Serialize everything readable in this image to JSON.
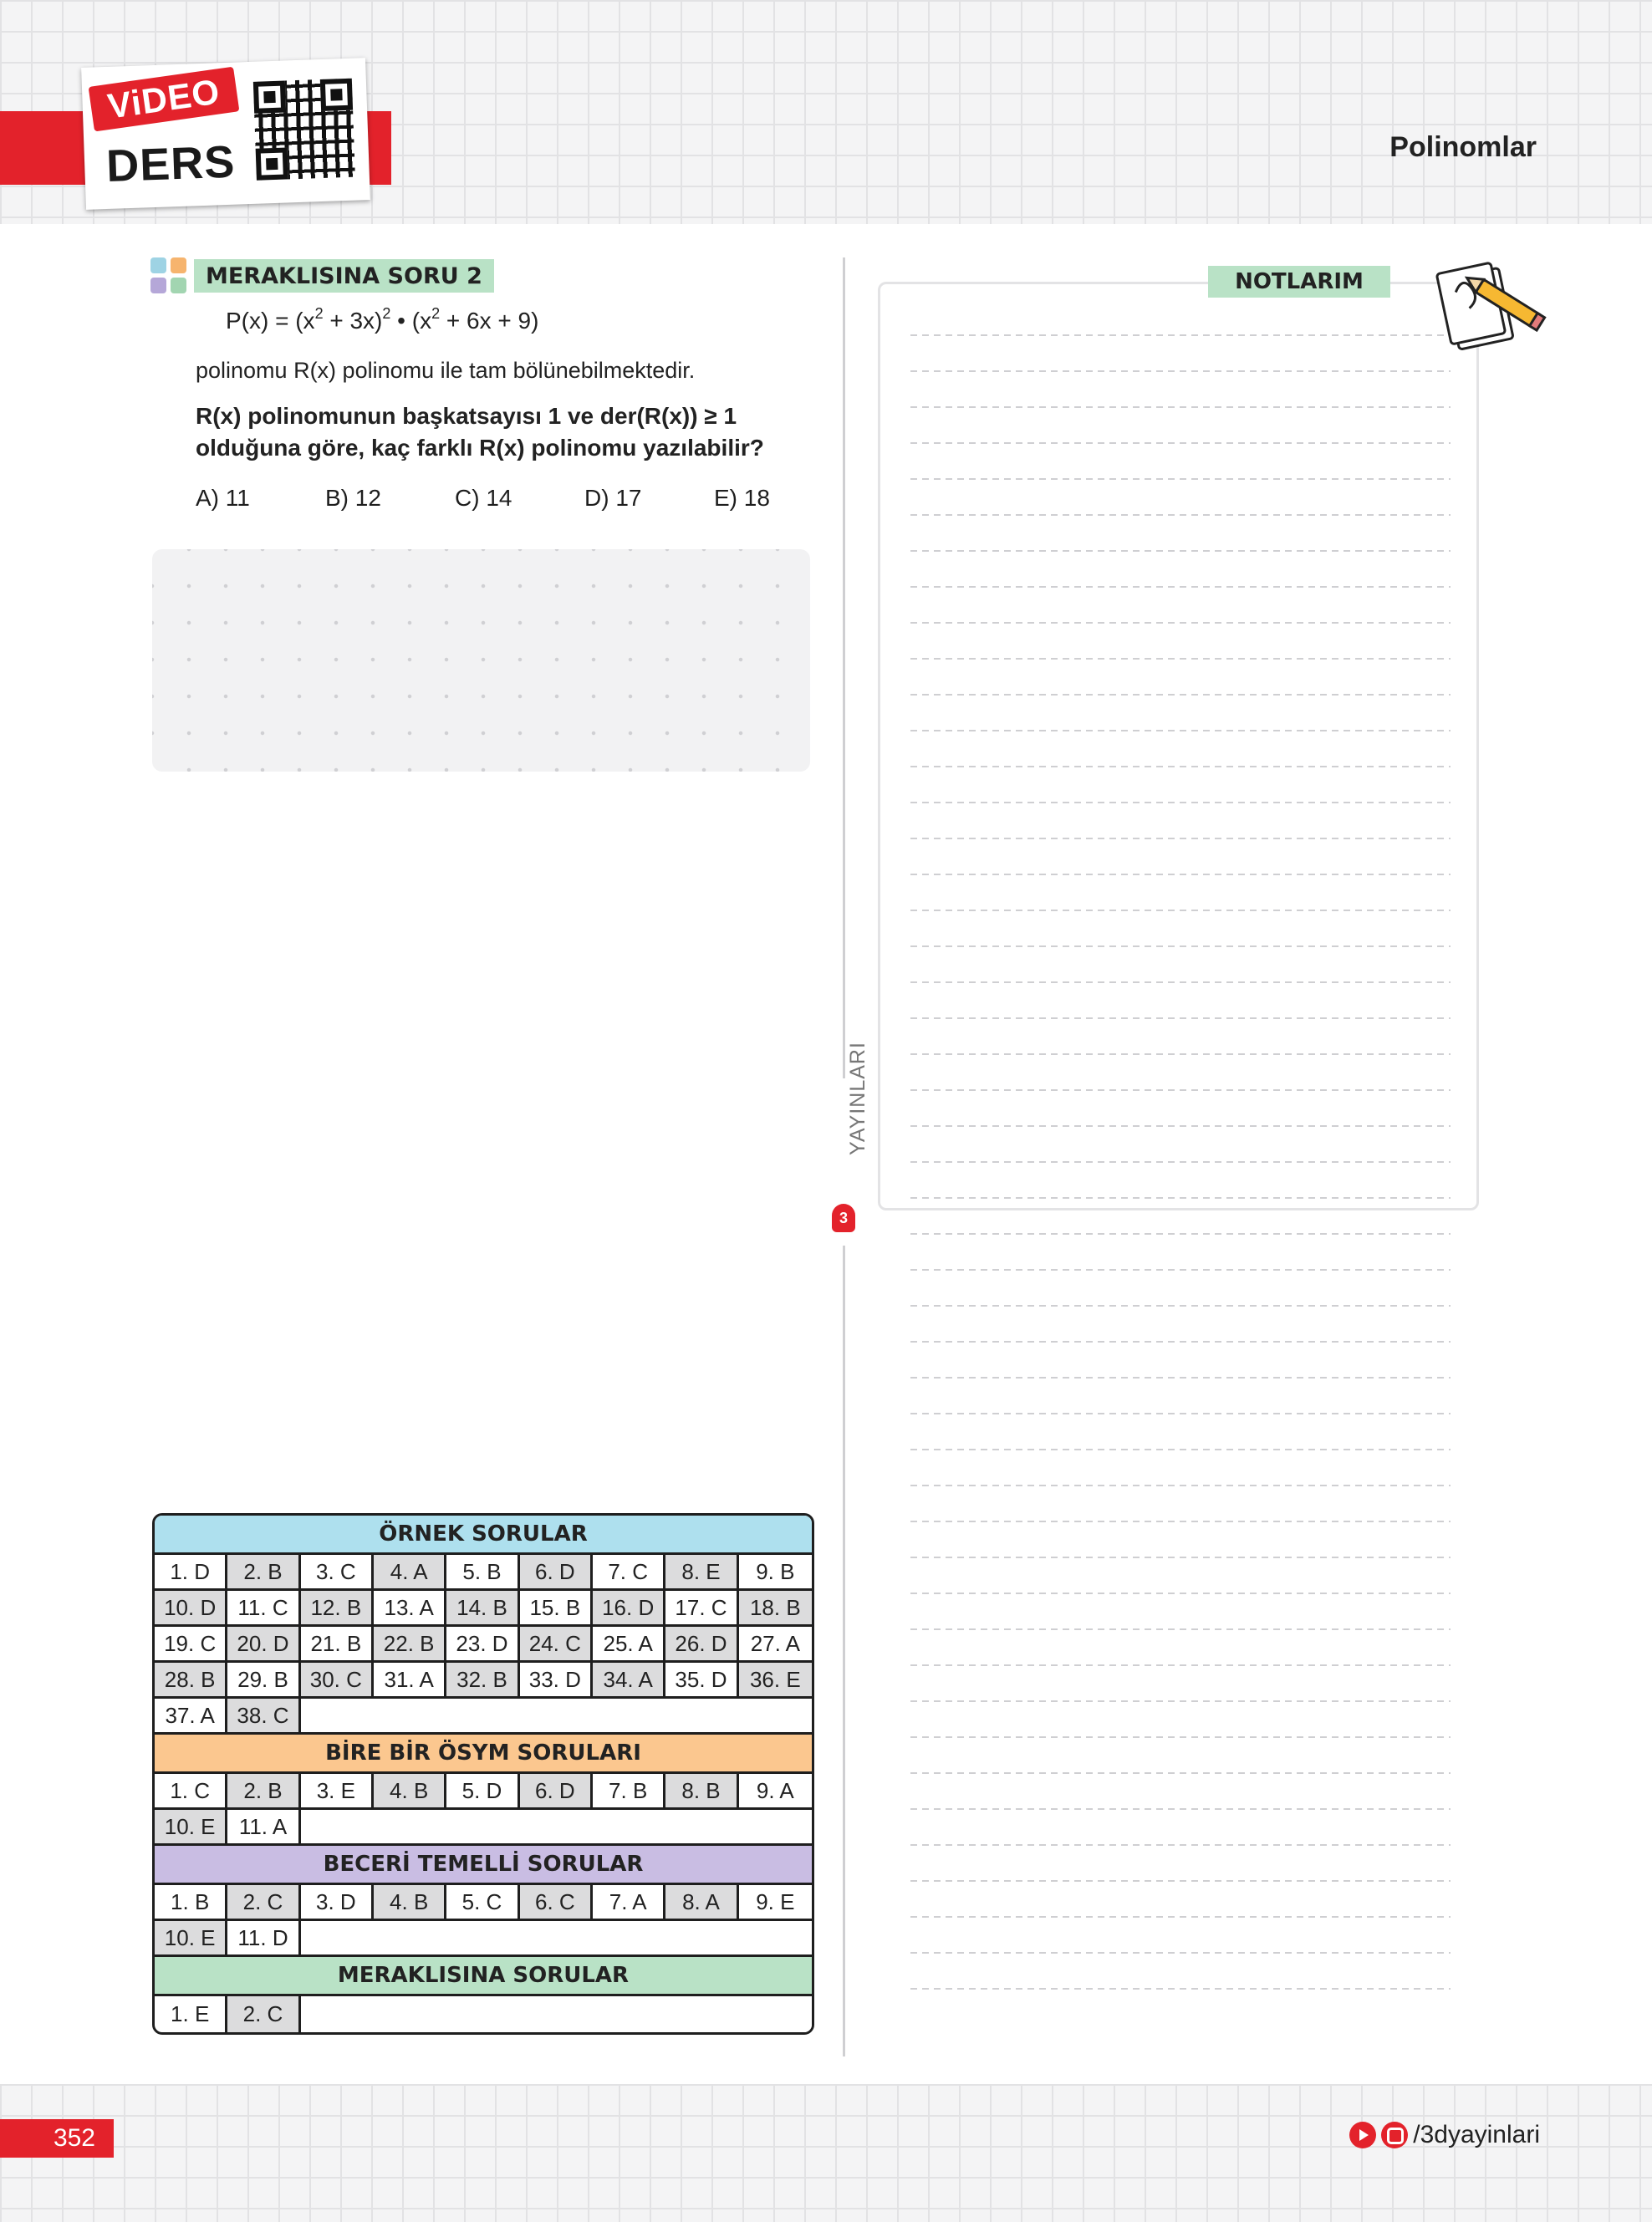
{
  "header": {
    "video_label": "ViDEO",
    "ders_label": "DERS",
    "title": "Polinomlar"
  },
  "question": {
    "tag": "MERAKLISINA SORU 2",
    "formula": {
      "lhs": "P(x) = ",
      "a": "(x",
      "a_exp": "2",
      "b": " + 3x)",
      "b_exp": "2",
      "c": " • (x",
      "c_exp": "2",
      "d": " + 6x + 9)"
    },
    "line1": "polinomu R(x) polinomu ile tam bölünebilmektedir.",
    "line2": "R(x) polinomunun başkatsayısı 1 ve der(R(x)) ≥ 1",
    "line3": "olduğuna göre, kaç farklı R(x) polinomu yazılabilir?",
    "options": [
      "A) 11",
      "B) 12",
      "C) 14",
      "D) 17",
      "E) 18"
    ]
  },
  "publisher": {
    "name": "YAYINLARI",
    "logo": "3"
  },
  "notes": {
    "label": "NOTLARIM"
  },
  "answer_key": {
    "sections": [
      {
        "title": "ÖRNEK SORULAR",
        "color": "#aee0ee",
        "answers": [
          "1. D",
          "2. B",
          "3. C",
          "4. A",
          "5. B",
          "6. D",
          "7. C",
          "8. E",
          "9. B",
          "10. D",
          "11. C",
          "12. B",
          "13. A",
          "14. B",
          "15. B",
          "16. D",
          "17. C",
          "18. B",
          "19. C",
          "20. D",
          "21. B",
          "22. B",
          "23. D",
          "24. C",
          "25. A",
          "26. D",
          "27. A",
          "28. B",
          "29. B",
          "30. C",
          "31. A",
          "32. B",
          "33. D",
          "34. A",
          "35. D",
          "36. E",
          "37. A",
          "38. C"
        ]
      },
      {
        "title": "BİRE BİR ÖSYM SORULARI",
        "color": "#fbc78f",
        "answers": [
          "1. C",
          "2. B",
          "3. E",
          "4. B",
          "5. D",
          "6. D",
          "7. B",
          "8. B",
          "9. A",
          "10. E",
          "11. A"
        ]
      },
      {
        "title": "BECERİ TEMELLİ SORULAR",
        "color": "#c9bde3",
        "answers": [
          "1. B",
          "2. C",
          "3. D",
          "4. B",
          "5. C",
          "6. C",
          "7. A",
          "8. A",
          "9. E",
          "10. E",
          "11. D"
        ]
      },
      {
        "title": "MERAKLISINA SORULAR",
        "color": "#b9e2c6",
        "answers": [
          "1. E",
          "2. C"
        ]
      }
    ]
  },
  "footer": {
    "page_number": "352",
    "social_handle": "/3dyayinlari"
  },
  "colors": {
    "brand_red": "#e3222b",
    "tag_green": "#b9e2c6",
    "shade_gray": "#dcdcdd"
  },
  "icons": [
    "qr-code-icon",
    "youtube-icon",
    "instagram-icon",
    "notes-pencil-icon",
    "grid-tiles-icon"
  ]
}
